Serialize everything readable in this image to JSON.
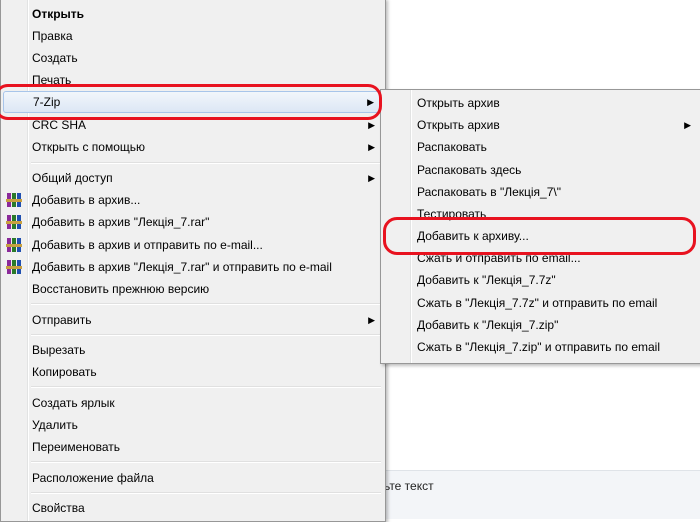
{
  "main_menu": {
    "items": [
      {
        "label": "Открыть"
      },
      {
        "label": "Правка"
      },
      {
        "label": "Создать"
      },
      {
        "label": "Печать"
      },
      {
        "label": "7-Zip"
      },
      {
        "label": "CRC SHA"
      },
      {
        "label": "Открыть с помощью"
      },
      {
        "label": "Общий доступ"
      },
      {
        "label": "Добавить в архив..."
      },
      {
        "label": "Добавить в архив \"Лекція_7.rar\""
      },
      {
        "label": "Добавить в архив и отправить по e-mail..."
      },
      {
        "label": "Добавить в архив \"Лекція_7.rar\" и отправить по e-mail"
      },
      {
        "label": "Восстановить прежнюю версию"
      },
      {
        "label": "Отправить"
      },
      {
        "label": "Вырезать"
      },
      {
        "label": "Копировать"
      },
      {
        "label": "Создать ярлык"
      },
      {
        "label": "Удалить"
      },
      {
        "label": "Переименовать"
      },
      {
        "label": "Расположение файла"
      },
      {
        "label": "Свойства"
      }
    ]
  },
  "sub_menu": {
    "items": [
      {
        "label": "Открыть архив"
      },
      {
        "label": "Открыть архив"
      },
      {
        "label": "Распаковать"
      },
      {
        "label": "Распаковать здесь"
      },
      {
        "label": "Распаковать в \"Лекція_7\\\""
      },
      {
        "label": "Тестировать"
      },
      {
        "label": "Добавить к архиву..."
      },
      {
        "label": "Сжать и отправить по email..."
      },
      {
        "label": "Добавить к \"Лекція_7.7z\""
      },
      {
        "label": "Сжать в \"Лекція_7.7z\" и отправить по email"
      },
      {
        "label": "Добавить к \"Лекція_7.zip\""
      },
      {
        "label": "Сжать в \"Лекція_7.zip\" и отправить по email"
      }
    ]
  },
  "background": {
    "partial_text": "ьте текст"
  },
  "colors": {
    "highlight_circle": "#e8121f",
    "menu_bg": "#f0f0f0",
    "winrar_icon": "winrar-books-icon"
  }
}
